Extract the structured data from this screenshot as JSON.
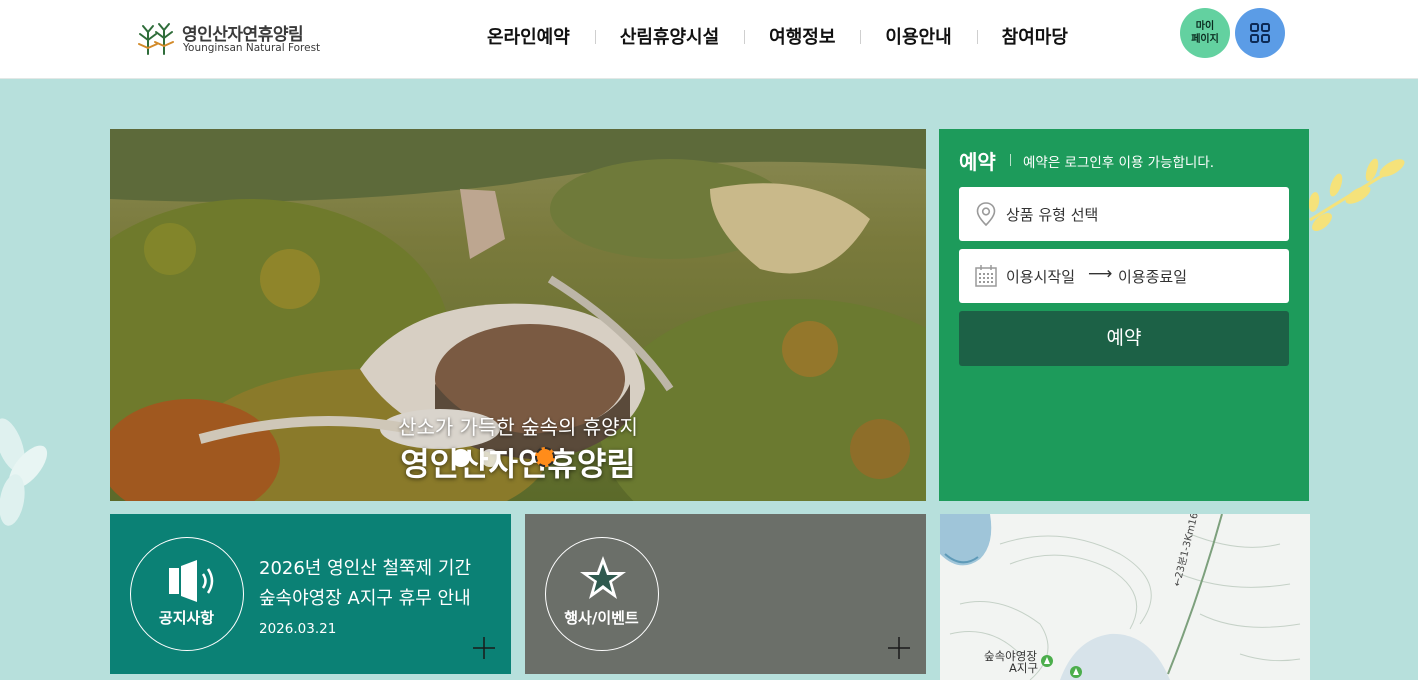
{
  "logo": {
    "name_kr": "영인산자연휴양림",
    "name_en": "Younginsan Natural Forest"
  },
  "nav": {
    "items": [
      {
        "label": "온라인예약"
      },
      {
        "label": "산림휴양시설"
      },
      {
        "label": "여행정보"
      },
      {
        "label": "이용안내"
      },
      {
        "label": "참여마당"
      }
    ]
  },
  "header_buttons": {
    "mypage_line1": "마이",
    "mypage_line2": "페이지",
    "menu_icon": "grid-icon"
  },
  "hero": {
    "subtitle": "산소가 가득한 숲속의 휴양지",
    "title": "영인산자연휴양림",
    "active_slide": 3,
    "slide_count": 3
  },
  "reservation": {
    "title": "예약",
    "note": "예약은 로그인후 이용 가능합니다.",
    "product_placeholder": "상품 유형 선택",
    "date_start": "이용시작일",
    "date_arrow": "⟶",
    "date_end": "이용종료일",
    "submit_label": "예약"
  },
  "notice_card": {
    "label": "공지사항",
    "line1": "2026년 영인산 철쭉제 기간",
    "line2": "숲속야영장 A지구 휴무 안내",
    "date": "2026.03.21"
  },
  "event_card": {
    "label": "행사/이벤트"
  },
  "map": {
    "label_line1": "숲속야영장",
    "label_line2": "A지구",
    "road_label": "←23분1-3Km16분→"
  },
  "colors": {
    "page_bg": "#b7e0dc",
    "reserve_panel": "#1d9b5b",
    "reserve_button": "#1c6146",
    "notice_card": "#0b8175",
    "event_card": "#6b6f69",
    "mypage_btn": "#63d1a0",
    "menu_btn": "#5b9ce6",
    "active_dot": "#ff8c1a"
  }
}
